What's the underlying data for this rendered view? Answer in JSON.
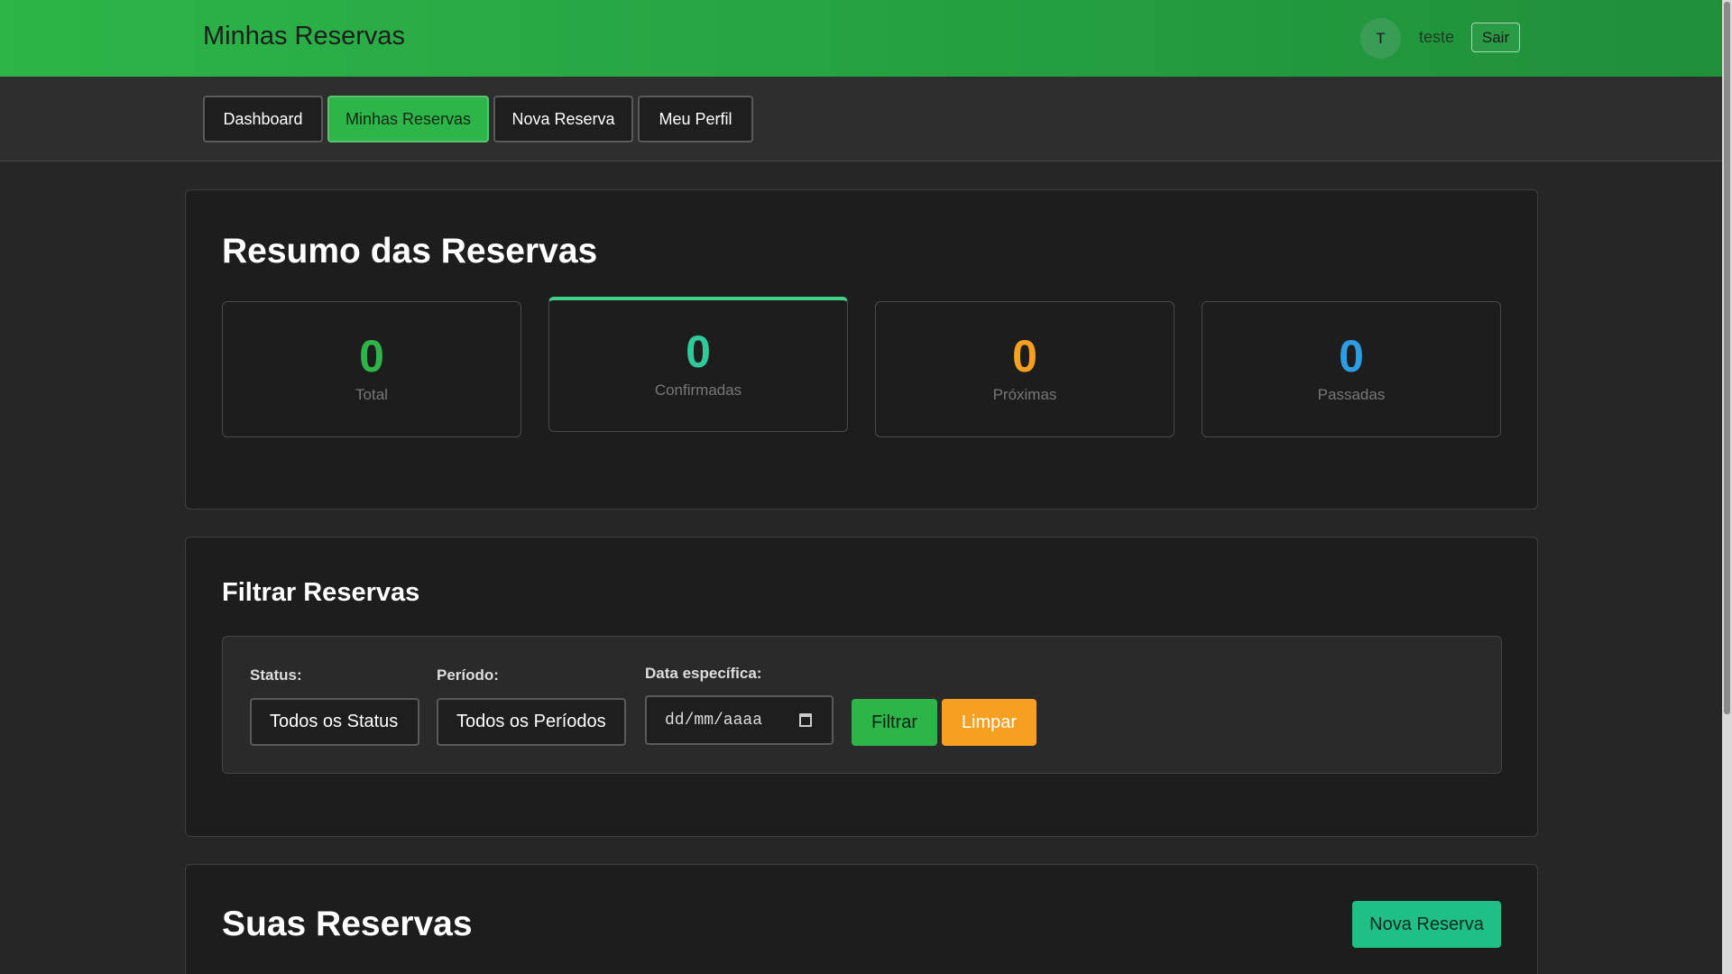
{
  "header": {
    "title": "Minhas Reservas",
    "avatar_initial": "T",
    "username": "teste",
    "logout_label": "Sair"
  },
  "nav": {
    "items": [
      {
        "label": "Dashboard",
        "active": false
      },
      {
        "label": "Minhas Reservas",
        "active": true
      },
      {
        "label": "Nova Reserva",
        "active": false
      },
      {
        "label": "Meu Perfil",
        "active": false
      }
    ]
  },
  "summary": {
    "title": "Resumo das Reservas",
    "stats": [
      {
        "value": "0",
        "label": "Total",
        "color": "#2db549"
      },
      {
        "value": "0",
        "label": "Confirmadas",
        "color": "#2fc99b"
      },
      {
        "value": "0",
        "label": "Próximas",
        "color": "#f5a020"
      },
      {
        "value": "0",
        "label": "Passadas",
        "color": "#2f9be0"
      }
    ]
  },
  "filters": {
    "title": "Filtrar Reservas",
    "status_label": "Status:",
    "status_value": "Todos os Status",
    "period_label": "Período:",
    "period_value": "Todos os Períodos",
    "date_label": "Data específica:",
    "date_placeholder": "dd/mm/aaaa",
    "filter_button": "Filtrar",
    "clear_button": "Limpar"
  },
  "reservations": {
    "title": "Suas Reservas",
    "new_button": "Nova Reserva"
  },
  "colors": {
    "accent_green": "#2db549",
    "teal": "#1fbf86",
    "orange": "#f5a020",
    "blue": "#2f9be0"
  }
}
